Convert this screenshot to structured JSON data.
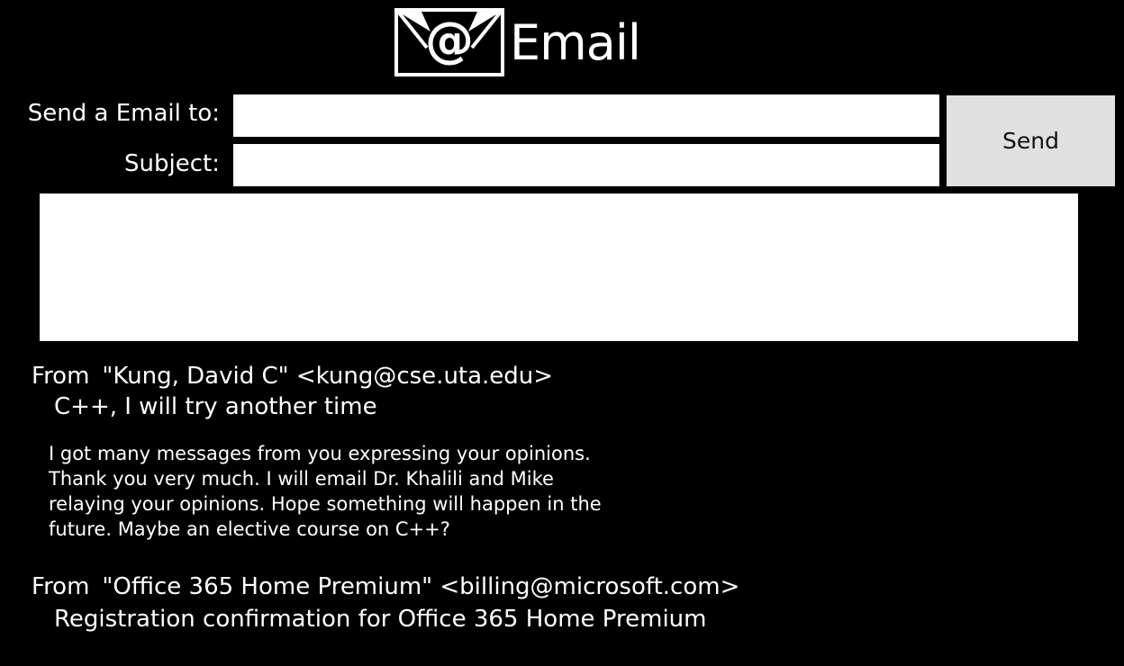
{
  "header": {
    "icon": "email-at-icon",
    "title": "Email"
  },
  "compose": {
    "to_label": "Send a Email to:",
    "to_value": "",
    "subject_label": "Subject:",
    "subject_value": "",
    "send_label": "Send",
    "body_value": ""
  },
  "messages": [
    {
      "from_prefix": "From",
      "from": "\"Kung, David C\" <kung@cse.uta.edu>",
      "subject": "C++, I will try another time",
      "body": [
        "I got many messages from you expressing your opinions.",
        "Thank you very much. I will email Dr. Khalili and Mike",
        "relaying your opinions. Hope something will happen in the",
        "future. Maybe an elective course on C++?"
      ]
    },
    {
      "from_prefix": "From",
      "from": "\"Office 365 Home Premium\" <billing@microsoft.com>",
      "subject": "Registration confirmation for Office 365 Home Premium"
    }
  ],
  "colors": {
    "background": "#000000",
    "text": "#ffffff",
    "input_background": "#ffffff",
    "button_background": "#e0e0e0"
  }
}
